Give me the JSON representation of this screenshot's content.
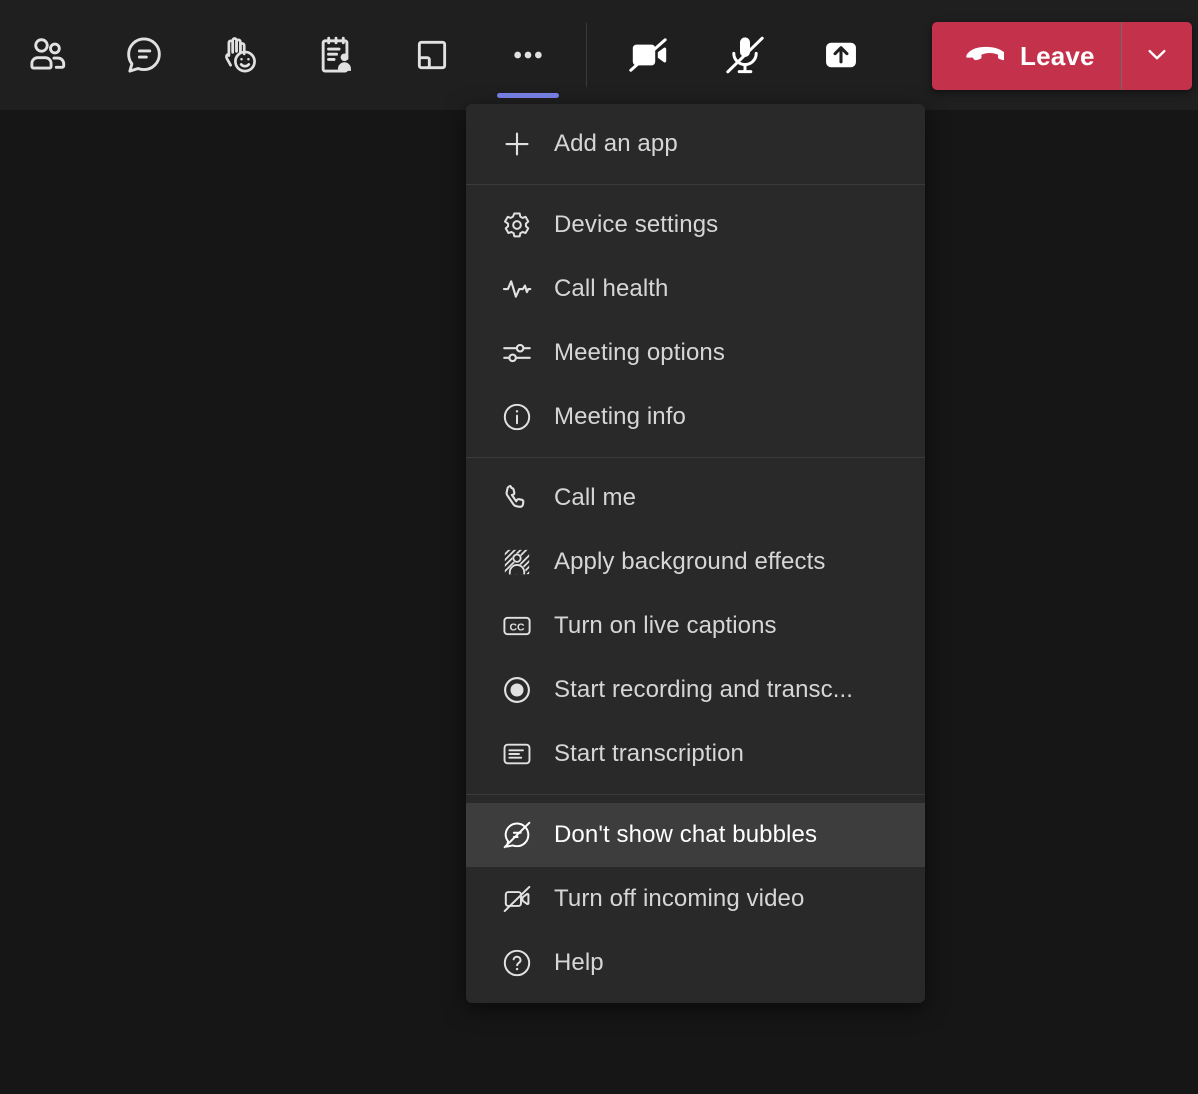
{
  "app": "Microsoft Teams meeting control bar",
  "colors": {
    "toolbar_bg": "#1f1f1f",
    "page_bg": "#161616",
    "menu_bg": "#292929",
    "menu_highlight_bg": "#3d3d3d",
    "accent_active": "#7b83eb",
    "leave_red": "#c4314b",
    "icon_stroke": "#e1e1e1",
    "menu_text": "#d6d6d6",
    "separator": "#3a3a3a"
  },
  "toolbar": {
    "buttons": [
      {
        "name": "people-icon",
        "tooltip": "Show participants",
        "active": false
      },
      {
        "name": "chat-icon",
        "tooltip": "Show conversation",
        "active": false
      },
      {
        "name": "raise-hand-reactions-icon",
        "tooltip": "React",
        "active": false
      },
      {
        "name": "notes-icon",
        "tooltip": "Meeting notes",
        "active": false
      },
      {
        "name": "breakout-rooms-icon",
        "tooltip": "Rooms",
        "active": false
      },
      {
        "name": "more-options-icon",
        "tooltip": "More actions",
        "active": true
      }
    ],
    "camera": {
      "label": "camera-off-icon",
      "state": "off"
    },
    "microphone": {
      "label": "microphone-off-icon",
      "state": "muted"
    },
    "share": {
      "label": "share-content-icon",
      "state": "default"
    },
    "leave": {
      "label": "Leave",
      "icon": "hang-up-icon",
      "caret_icon": "chevron-down-icon"
    }
  },
  "menu": {
    "sections": [
      {
        "items": [
          {
            "icon": "plus-icon",
            "label": "Add an app",
            "highlighted": false
          }
        ]
      },
      {
        "items": [
          {
            "icon": "gear-icon",
            "label": "Device settings",
            "highlighted": false
          },
          {
            "icon": "pulse-icon",
            "label": "Call health",
            "highlighted": false
          },
          {
            "icon": "sliders-icon",
            "label": "Meeting options",
            "highlighted": false
          },
          {
            "icon": "info-icon",
            "label": "Meeting info",
            "highlighted": false
          }
        ]
      },
      {
        "items": [
          {
            "icon": "phone-icon",
            "label": "Call me",
            "highlighted": false
          },
          {
            "icon": "background-effects-icon",
            "label": "Apply background effects",
            "highlighted": false
          },
          {
            "icon": "closed-captions-icon",
            "label": "Turn on live captions",
            "highlighted": false
          },
          {
            "icon": "record-icon",
            "label": "Start recording and transc...",
            "highlighted": false
          },
          {
            "icon": "transcription-icon",
            "label": "Start transcription",
            "highlighted": false
          }
        ]
      },
      {
        "items": [
          {
            "icon": "chat-bubble-off-icon",
            "label": "Don't show chat bubbles",
            "highlighted": true
          },
          {
            "icon": "camera-off-icon",
            "label": "Turn off incoming video",
            "highlighted": false
          },
          {
            "icon": "help-icon",
            "label": "Help",
            "highlighted": false
          }
        ]
      }
    ]
  }
}
